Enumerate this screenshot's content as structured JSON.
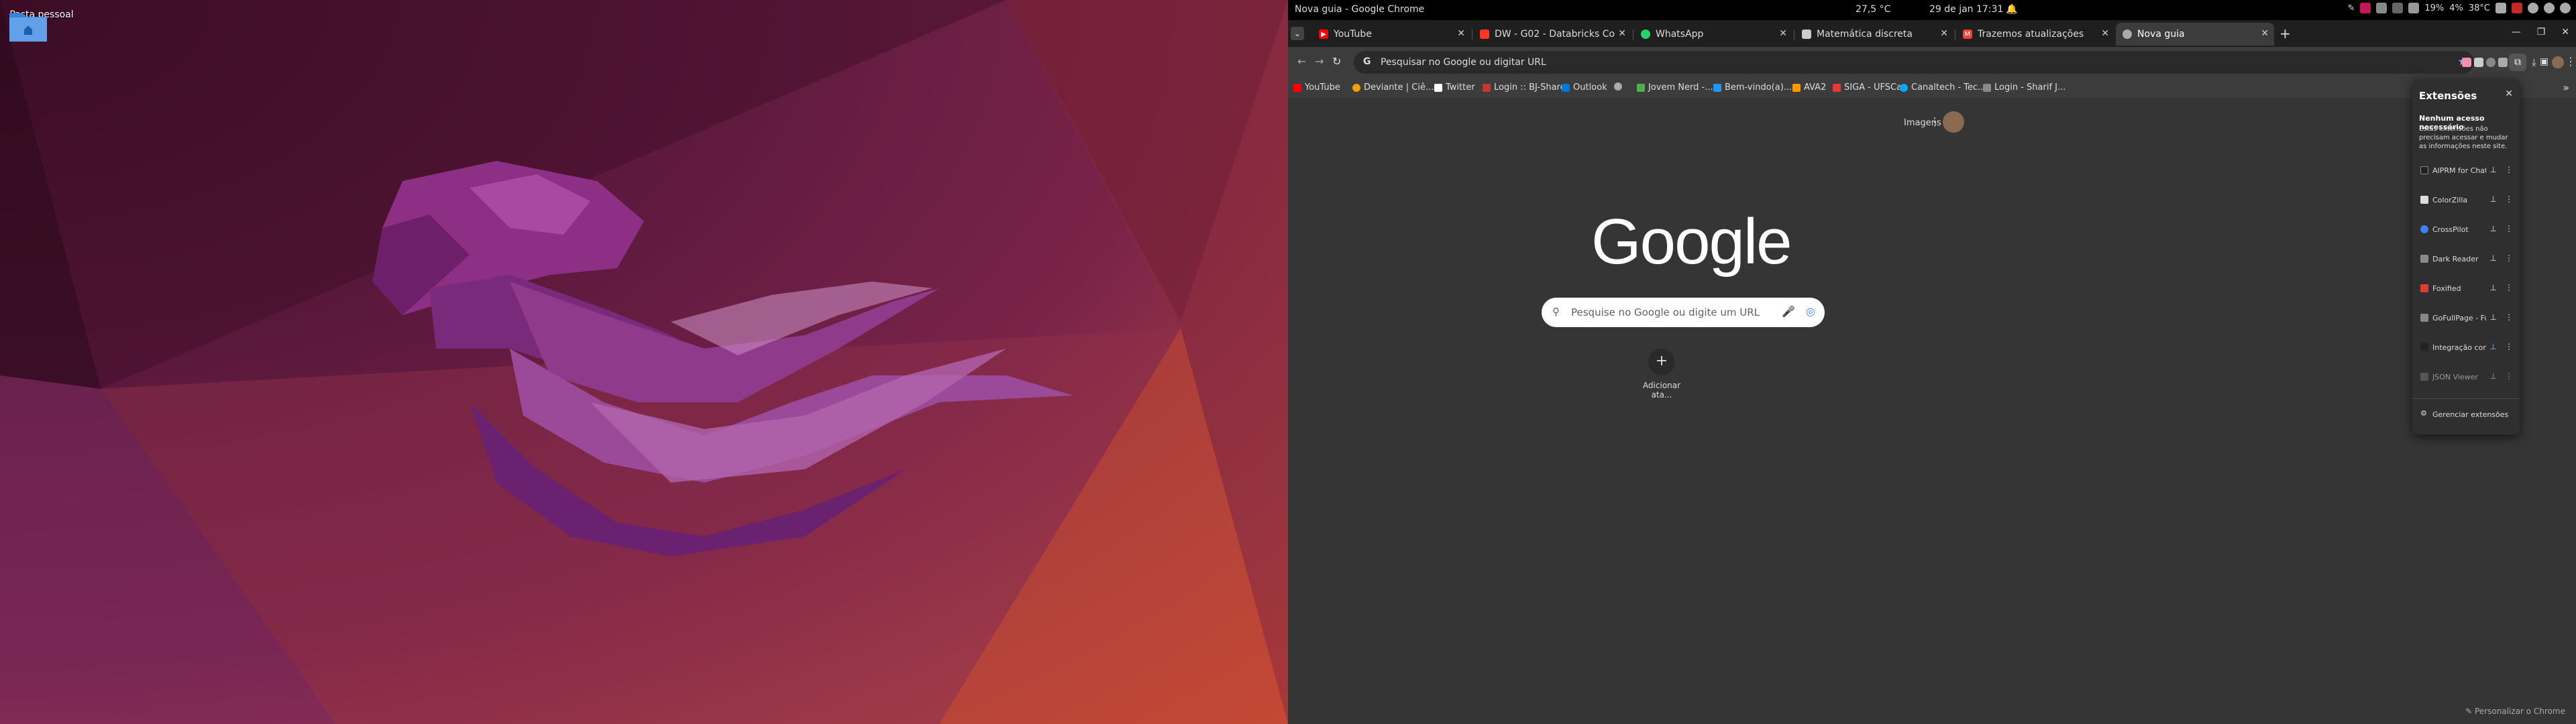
{
  "desktop": {
    "folder_label": "Pasta pessoal"
  },
  "topbar": {
    "window_title": "Nova guia - Google Chrome",
    "weather": "27,5 °C",
    "clock": "29 de jan  17:31",
    "tray": {
      "cpu": "19%",
      "mem": "4%",
      "temp": "38°C"
    }
  },
  "tabs": [
    {
      "title": "YouTube",
      "fav_color": "#ff0000",
      "active": false
    },
    {
      "title": "DW - G02 - Databricks Co",
      "fav_color": "#ff3621",
      "active": false
    },
    {
      "title": "WhatsApp",
      "fav_color": "#25d366",
      "active": false
    },
    {
      "title": "Matemática discreta",
      "fav_color": "#cccccc",
      "active": false
    },
    {
      "title": "Trazemos atualizações",
      "fav_color": "#ea4335",
      "active": false
    },
    {
      "title": "Nova guia",
      "fav_color": "#aaaaaa",
      "active": true
    }
  ],
  "omnibox": {
    "placeholder": "Pesquisar no Google ou digitar URL",
    "prefix": "G"
  },
  "bookmarks": [
    {
      "label": "YouTube",
      "color": "#ff0000"
    },
    {
      "label": "Deviante | Ciê...",
      "color": "#f0a000"
    },
    {
      "label": "Twitter",
      "color": "#ffffff"
    },
    {
      "label": "Login :: BJ-Share",
      "color": "#c0392b"
    },
    {
      "label": "Outlook",
      "color": "#0078d4"
    },
    {
      "label": "",
      "color": "#aaaaaa"
    },
    {
      "label": "Jovem Nerd -...",
      "color": "#4caf50"
    },
    {
      "label": "Bem-vindo(a)...",
      "color": "#2196f3"
    },
    {
      "label": "AVA2",
      "color": "#ff9800"
    },
    {
      "label": "SIGA - UFSCar",
      "color": "#e53935"
    },
    {
      "label": "Canaltech - Tec...",
      "color": "#03a9f4"
    },
    {
      "label": "Login - Sharif J...",
      "color": "#888888"
    }
  ],
  "ntp": {
    "logo": "Google",
    "search_placeholder": "Pesquise no Google ou digite um URL",
    "shortcut_add": "Adicionar ata...",
    "imagens": "Imagens",
    "customize": "Personalizar o Chrome"
  },
  "extensions_panel": {
    "title": "Extensões",
    "section": "Nenhum acesso necessário",
    "description": "Estas extensões não precisam acessar e mudar as informações neste site.",
    "items": [
      {
        "name": "AIPRM for ChatGPT",
        "color": "#222222",
        "pinned": false
      },
      {
        "name": "ColorZilla",
        "color": "#dddddd",
        "pinned": false
      },
      {
        "name": "CrossPilot",
        "color": "#3b82f6",
        "pinned": false
      },
      {
        "name": "Dark Reader",
        "color": "#8a8a8a",
        "pinned": false
      },
      {
        "name": "Foxified",
        "color": "#e53935",
        "pinned": false
      },
      {
        "name": "GoFullPage - Full Pa...",
        "color": "#888888",
        "pinned": false
      },
      {
        "name": "Integração com GN...",
        "color": "#222222",
        "pinned": true
      },
      {
        "name": "JSON Viewer",
        "color": "#555555",
        "pinned": false
      }
    ],
    "manage_label": "Gerenciar extensões"
  }
}
